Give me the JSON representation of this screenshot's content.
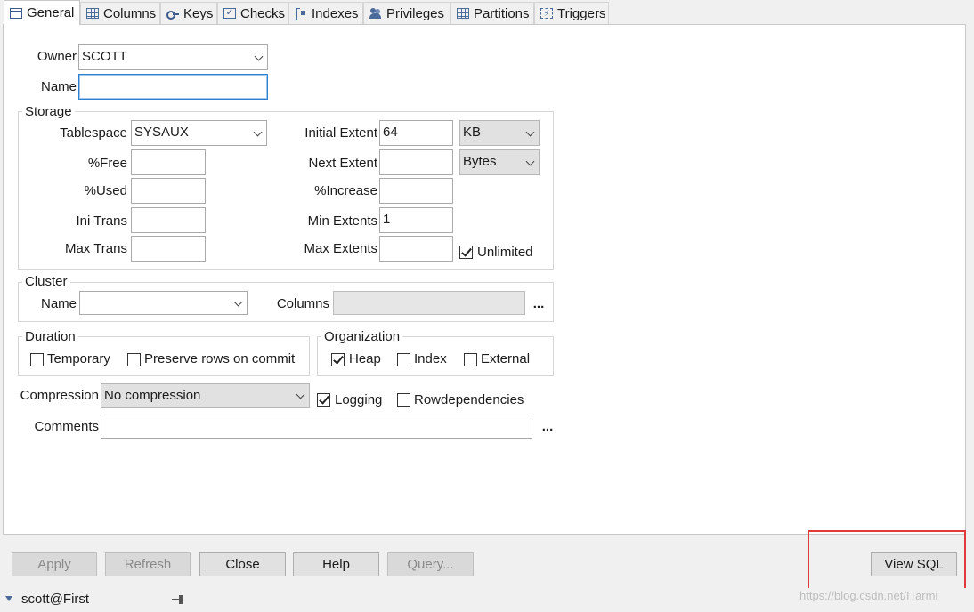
{
  "tabs": [
    {
      "label": "General",
      "icon": "general-tab-icon"
    },
    {
      "label": "Columns",
      "icon": "columns-tab-icon"
    },
    {
      "label": "Keys",
      "icon": "key-icon"
    },
    {
      "label": "Checks",
      "icon": "checks-tab-icon"
    },
    {
      "label": "Indexes",
      "icon": "indexes-tab-icon"
    },
    {
      "label": "Privileges",
      "icon": "users-icon"
    },
    {
      "label": "Partitions",
      "icon": "partitions-tab-icon"
    },
    {
      "label": "Triggers",
      "icon": "triggers-tab-icon"
    }
  ],
  "general": {
    "owner_label": "Owner",
    "owner_value": "SCOTT",
    "name_label": "Name",
    "name_value": ""
  },
  "storage": {
    "title": "Storage",
    "tablespace_label": "Tablespace",
    "tablespace_value": "SYSAUX",
    "free_label": "%Free",
    "free_value": "",
    "used_label": "%Used",
    "used_value": "",
    "ini_trans_label": "Ini Trans",
    "ini_trans_value": "",
    "max_trans_label": "Max Trans",
    "max_trans_value": "",
    "initial_extent_label": "Initial Extent",
    "initial_extent_value": "64",
    "initial_extent_unit": "KB",
    "next_extent_label": "Next Extent",
    "next_extent_value": "",
    "next_extent_unit": "Bytes",
    "increase_label": "%Increase",
    "increase_value": "",
    "min_extents_label": "Min Extents",
    "min_extents_value": "1",
    "max_extents_label": "Max Extents",
    "max_extents_value": "",
    "unlimited_label": "Unlimited",
    "unlimited_checked": true
  },
  "cluster": {
    "title": "Cluster",
    "name_label": "Name",
    "name_value": "",
    "columns_label": "Columns",
    "columns_value": "",
    "more": "..."
  },
  "duration": {
    "title": "Duration",
    "temporary_label": "Temporary",
    "temporary_checked": false,
    "preserve_label": "Preserve rows on commit",
    "preserve_checked": false
  },
  "organization": {
    "title": "Organization",
    "heap_label": "Heap",
    "heap_checked": true,
    "index_label": "Index",
    "index_checked": false,
    "external_label": "External",
    "external_checked": false
  },
  "misc": {
    "compression_label": "Compression",
    "compression_value": "No compression",
    "logging_label": "Logging",
    "logging_checked": true,
    "rowdep_label": "Rowdependencies",
    "rowdep_checked": false,
    "comments_label": "Comments",
    "comments_value": "",
    "more": "..."
  },
  "buttons": {
    "apply": "Apply",
    "refresh": "Refresh",
    "close": "Close",
    "help": "Help",
    "query": "Query...",
    "view_sql": "View SQL"
  },
  "status": {
    "connection": "scott@First"
  },
  "watermark": "https://blog.csdn.net/ITarmi",
  "colors": {
    "highlight_box": "#e03a3a",
    "focus_border": "#2f7fcf"
  }
}
